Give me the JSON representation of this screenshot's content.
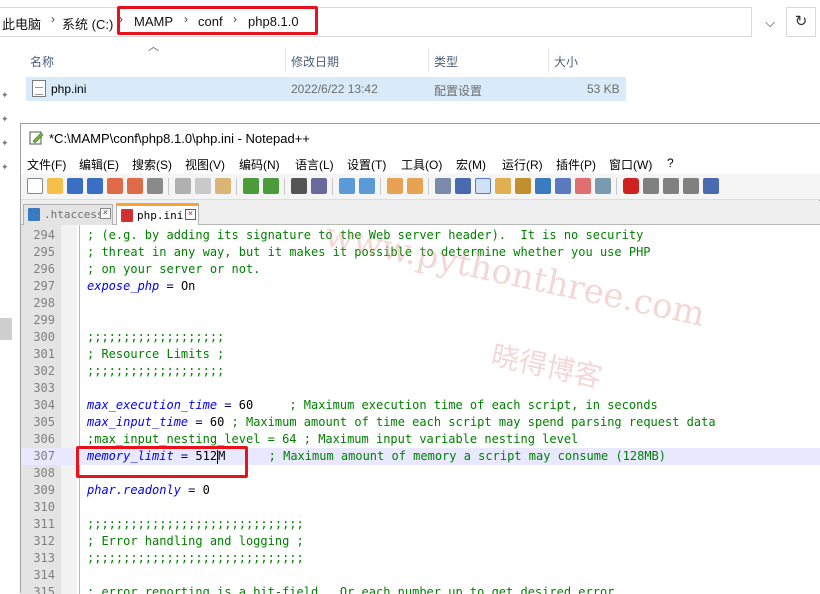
{
  "explorer": {
    "breadcrumb": [
      "此电脑",
      "系统 (C:)",
      "MAMP",
      "conf",
      "php8.1.0"
    ],
    "columns": {
      "name": "名称",
      "modified": "修改日期",
      "type": "类型",
      "size": "大小"
    },
    "file": {
      "name": "php.ini",
      "modified": "2022/6/22 13:42",
      "type": "配置设置",
      "size": "53 KB"
    }
  },
  "npp": {
    "title": "*C:\\MAMP\\conf\\php8.1.0\\php.ini - Notepad++",
    "menu": [
      "文件(F)",
      "编辑(E)",
      "搜索(S)",
      "视图(V)",
      "编码(N)",
      "语言(L)",
      "设置(T)",
      "工具(O)",
      "宏(M)",
      "运行(R)",
      "插件(P)",
      "窗口(W)",
      "?"
    ],
    "tabs": [
      {
        "label": ".htaccess",
        "active": false
      },
      {
        "label": "php.ini",
        "active": true
      }
    ],
    "lines": [
      {
        "n": "294",
        "text": "; (e.g. by adding its signature to the Web server header).  It is no security"
      },
      {
        "n": "295",
        "text": "; threat in any way, but it makes it possible to determine whether you use PHP"
      },
      {
        "n": "296",
        "text": "; on your server or not."
      },
      {
        "n": "297",
        "key": "expose_php",
        "eq": " = ",
        "val": "On",
        "text": ""
      },
      {
        "n": "298",
        "text": ""
      },
      {
        "n": "299",
        "text": ""
      },
      {
        "n": "300",
        "text": ";;;;;;;;;;;;;;;;;;;"
      },
      {
        "n": "301",
        "text": "; Resource Limits ;"
      },
      {
        "n": "302",
        "text": ";;;;;;;;;;;;;;;;;;;"
      },
      {
        "n": "303",
        "text": ""
      },
      {
        "n": "304",
        "key": "max_execution_time",
        "eq": " = ",
        "val": "60     ",
        "text": "; Maximum execution time of each script, in seconds"
      },
      {
        "n": "305",
        "key": "max_input_time",
        "eq": " = ",
        "val": "60 ",
        "text": "; Maximum amount of time each script may spend parsing request data"
      },
      {
        "n": "306",
        "text": ";max_input_nesting_level = 64 ; Maximum input variable nesting level"
      },
      {
        "n": "307",
        "key": "memory_limit",
        "eq": " = ",
        "val": "512M      ",
        "text": "; Maximum amount of memory a script may consume (128MB)"
      },
      {
        "n": "308",
        "text": ""
      },
      {
        "n": "309",
        "key": "phar.readonly",
        "eq": " = ",
        "val": "0",
        "text": ""
      },
      {
        "n": "310",
        "text": ""
      },
      {
        "n": "311",
        "text": ";;;;;;;;;;;;;;;;;;;;;;;;;;;;;;"
      },
      {
        "n": "312",
        "text": "; Error handling and logging ;"
      },
      {
        "n": "313",
        "text": ";;;;;;;;;;;;;;;;;;;;;;;;;;;;;;"
      },
      {
        "n": "314",
        "text": ""
      },
      {
        "n": "315",
        "text": "; error_reporting is a bit-field.  Or each number up to get desired error"
      }
    ]
  },
  "watermark": {
    "url": "www.pythonthree.com",
    "cn": "晓得博客"
  },
  "colors": {
    "highlight_box": "#e8121c",
    "comment": "#008000",
    "keyword": "#0000ff",
    "selected_row": "#d9ebf9"
  }
}
